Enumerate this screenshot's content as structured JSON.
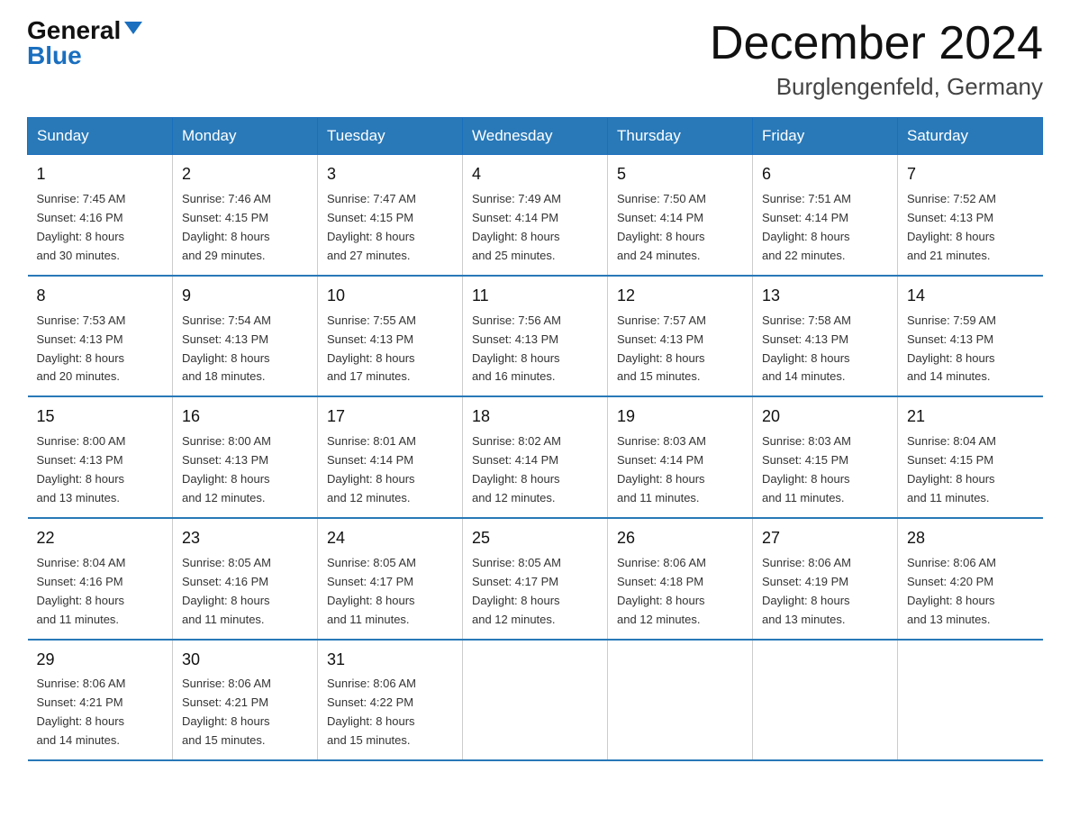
{
  "header": {
    "logo_general": "General",
    "logo_blue": "Blue",
    "month_title": "December 2024",
    "location": "Burglengenfeld, Germany"
  },
  "columns": [
    "Sunday",
    "Monday",
    "Tuesday",
    "Wednesday",
    "Thursday",
    "Friday",
    "Saturday"
  ],
  "weeks": [
    [
      {
        "day": "1",
        "sunrise": "7:45 AM",
        "sunset": "4:16 PM",
        "daylight": "8 hours and 30 minutes."
      },
      {
        "day": "2",
        "sunrise": "7:46 AM",
        "sunset": "4:15 PM",
        "daylight": "8 hours and 29 minutes."
      },
      {
        "day": "3",
        "sunrise": "7:47 AM",
        "sunset": "4:15 PM",
        "daylight": "8 hours and 27 minutes."
      },
      {
        "day": "4",
        "sunrise": "7:49 AM",
        "sunset": "4:14 PM",
        "daylight": "8 hours and 25 minutes."
      },
      {
        "day": "5",
        "sunrise": "7:50 AM",
        "sunset": "4:14 PM",
        "daylight": "8 hours and 24 minutes."
      },
      {
        "day": "6",
        "sunrise": "7:51 AM",
        "sunset": "4:14 PM",
        "daylight": "8 hours and 22 minutes."
      },
      {
        "day": "7",
        "sunrise": "7:52 AM",
        "sunset": "4:13 PM",
        "daylight": "8 hours and 21 minutes."
      }
    ],
    [
      {
        "day": "8",
        "sunrise": "7:53 AM",
        "sunset": "4:13 PM",
        "daylight": "8 hours and 20 minutes."
      },
      {
        "day": "9",
        "sunrise": "7:54 AM",
        "sunset": "4:13 PM",
        "daylight": "8 hours and 18 minutes."
      },
      {
        "day": "10",
        "sunrise": "7:55 AM",
        "sunset": "4:13 PM",
        "daylight": "8 hours and 17 minutes."
      },
      {
        "day": "11",
        "sunrise": "7:56 AM",
        "sunset": "4:13 PM",
        "daylight": "8 hours and 16 minutes."
      },
      {
        "day": "12",
        "sunrise": "7:57 AM",
        "sunset": "4:13 PM",
        "daylight": "8 hours and 15 minutes."
      },
      {
        "day": "13",
        "sunrise": "7:58 AM",
        "sunset": "4:13 PM",
        "daylight": "8 hours and 14 minutes."
      },
      {
        "day": "14",
        "sunrise": "7:59 AM",
        "sunset": "4:13 PM",
        "daylight": "8 hours and 14 minutes."
      }
    ],
    [
      {
        "day": "15",
        "sunrise": "8:00 AM",
        "sunset": "4:13 PM",
        "daylight": "8 hours and 13 minutes."
      },
      {
        "day": "16",
        "sunrise": "8:00 AM",
        "sunset": "4:13 PM",
        "daylight": "8 hours and 12 minutes."
      },
      {
        "day": "17",
        "sunrise": "8:01 AM",
        "sunset": "4:14 PM",
        "daylight": "8 hours and 12 minutes."
      },
      {
        "day": "18",
        "sunrise": "8:02 AM",
        "sunset": "4:14 PM",
        "daylight": "8 hours and 12 minutes."
      },
      {
        "day": "19",
        "sunrise": "8:03 AM",
        "sunset": "4:14 PM",
        "daylight": "8 hours and 11 minutes."
      },
      {
        "day": "20",
        "sunrise": "8:03 AM",
        "sunset": "4:15 PM",
        "daylight": "8 hours and 11 minutes."
      },
      {
        "day": "21",
        "sunrise": "8:04 AM",
        "sunset": "4:15 PM",
        "daylight": "8 hours and 11 minutes."
      }
    ],
    [
      {
        "day": "22",
        "sunrise": "8:04 AM",
        "sunset": "4:16 PM",
        "daylight": "8 hours and 11 minutes."
      },
      {
        "day": "23",
        "sunrise": "8:05 AM",
        "sunset": "4:16 PM",
        "daylight": "8 hours and 11 minutes."
      },
      {
        "day": "24",
        "sunrise": "8:05 AM",
        "sunset": "4:17 PM",
        "daylight": "8 hours and 11 minutes."
      },
      {
        "day": "25",
        "sunrise": "8:05 AM",
        "sunset": "4:17 PM",
        "daylight": "8 hours and 12 minutes."
      },
      {
        "day": "26",
        "sunrise": "8:06 AM",
        "sunset": "4:18 PM",
        "daylight": "8 hours and 12 minutes."
      },
      {
        "day": "27",
        "sunrise": "8:06 AM",
        "sunset": "4:19 PM",
        "daylight": "8 hours and 13 minutes."
      },
      {
        "day": "28",
        "sunrise": "8:06 AM",
        "sunset": "4:20 PM",
        "daylight": "8 hours and 13 minutes."
      }
    ],
    [
      {
        "day": "29",
        "sunrise": "8:06 AM",
        "sunset": "4:21 PM",
        "daylight": "8 hours and 14 minutes."
      },
      {
        "day": "30",
        "sunrise": "8:06 AM",
        "sunset": "4:21 PM",
        "daylight": "8 hours and 15 minutes."
      },
      {
        "day": "31",
        "sunrise": "8:06 AM",
        "sunset": "4:22 PM",
        "daylight": "8 hours and 15 minutes."
      },
      null,
      null,
      null,
      null
    ]
  ],
  "labels": {
    "sunrise": "Sunrise:",
    "sunset": "Sunset:",
    "daylight": "Daylight:"
  }
}
